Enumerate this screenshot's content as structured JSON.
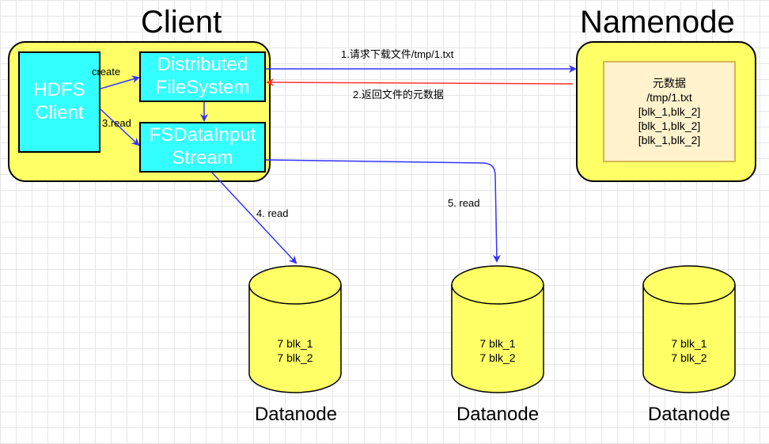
{
  "client_title": "Client",
  "namenode_title": "Namenode",
  "hdfs_client": [
    "HDFS",
    "Client"
  ],
  "distributed_fs": [
    "Distributed",
    "FileSystem"
  ],
  "fs_input_stream": [
    "FSDataInput",
    "Stream"
  ],
  "edges": {
    "create": "create",
    "read3": "3.read",
    "request": "1.请求下载文件/tmp/1.txt",
    "return": "2.返回文件的元数据",
    "read4": "4. read",
    "read5": "5. read"
  },
  "metadata": {
    "title": "元数据",
    "path": "/tmp/1.txt",
    "blocks": [
      "[blk_1,blk_2]",
      "[blk_1,blk_2]",
      "[blk_1,blk_2]"
    ]
  },
  "datanodes": [
    {
      "label": "Datanode",
      "blocks": [
        "7 blk_1",
        "7 blk_2"
      ]
    },
    {
      "label": "Datanode",
      "blocks": [
        "7 blk_1",
        "7 blk_2"
      ]
    },
    {
      "label": "Datanode",
      "blocks": [
        "7 blk_1",
        "7 blk_2"
      ]
    }
  ],
  "colors": {
    "arrow_blue": "#3333ff",
    "arrow_red": "#ff3333",
    "yellow": "#ffff66",
    "cyan": "#33ffff"
  }
}
